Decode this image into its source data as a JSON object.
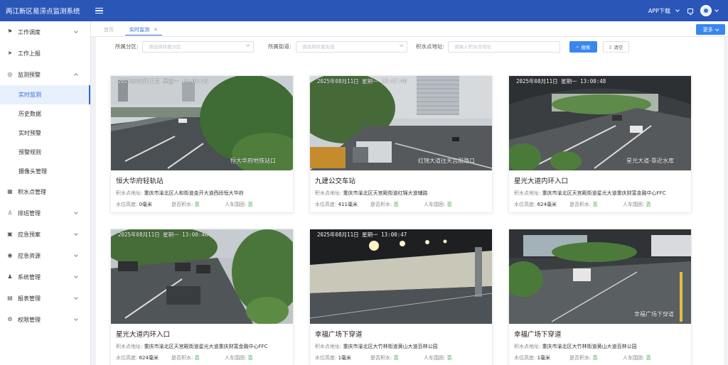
{
  "header": {
    "title": "两江新区易涝点监测系统",
    "app_download": "APP下载"
  },
  "sidebar": {
    "items": [
      {
        "label": "工作调度",
        "icon": "flag-icon",
        "expandable": true
      },
      {
        "label": "工作上报",
        "icon": "send-icon",
        "expandable": false
      },
      {
        "label": "监测预警",
        "icon": "alert-circle-icon",
        "expandable": true,
        "expanded": true,
        "children": [
          "实时监测",
          "历史数据",
          "实时预警",
          "预警规则",
          "摄像头管理"
        ]
      },
      {
        "label": "积水点管理",
        "icon": "grid-icon",
        "expandable": false
      },
      {
        "label": "排班管理",
        "icon": "user-icon",
        "expandable": true
      },
      {
        "label": "应急预案",
        "icon": "apps-icon",
        "expandable": true
      },
      {
        "label": "应急资源",
        "icon": "resource-icon",
        "expandable": true
      },
      {
        "label": "系统管理",
        "icon": "person-icon",
        "expandable": true
      },
      {
        "label": "报表管理",
        "icon": "report-icon",
        "expandable": true
      },
      {
        "label": "权限管理",
        "icon": "gear-icon",
        "expandable": true
      }
    ],
    "active_child": "实时监测"
  },
  "tabs": {
    "home": "首页",
    "active": "实时监测",
    "more": "更多"
  },
  "filters": {
    "district_label": "所属分区:",
    "district_placeholder": "请选择所属分区",
    "street_label": "所属街道:",
    "street_placeholder": "请选择所属街道",
    "point_label": "积水点地址:",
    "point_placeholder": "请输入积水点地址",
    "search": "搜索",
    "reset": "清空"
  },
  "labels": {
    "address": "积水点地址:",
    "water_level": "水位高度:",
    "is_flooded": "是否积水:",
    "car_trapped": "人车围困:"
  },
  "cards": [
    {
      "name": "恒大华府轻轨站",
      "address": "重庆市渝北区人和街道金开大道西段恒大华府",
      "water_level": "0毫米",
      "is_flooded": "否",
      "car_trapped": "否",
      "stamp": "2025年08月11日  星期一  13:00:46",
      "caption": "恒大华府地铁站口",
      "scene": "road"
    },
    {
      "name": "九建公交车站",
      "address": "重庆市渝北区天宫殿街道红锦大道辅路",
      "water_level": "411毫米",
      "is_flooded": "否",
      "car_trapped": "否",
      "stamp": "2025年08月11日  星期一  13:47:40",
      "caption": "红锦大道往天宫殿路口",
      "scene": "street"
    },
    {
      "name": "星光大道内环入口",
      "address": "重庆市渝北区天宫殿街道星光大道重庆财富金融中心FFC",
      "water_level": "624毫米",
      "is_flooded": "否",
      "car_trapped": "否",
      "stamp": "2025年08月11日  星期一  13:00:48",
      "caption": "星光大道-靠近水库",
      "scene": "bridge"
    },
    {
      "name": "星光大道内环入口",
      "address": "重庆市渝北区天宫殿街道星光大道重庆财富金融中心FFC",
      "water_level": "624毫米",
      "is_flooded": "否",
      "car_trapped": "否",
      "stamp": "2025年08月11日  星期一  13:00:46",
      "caption": "",
      "scene": "avenue"
    },
    {
      "name": "幸福广场下穿道",
      "address": "重庆市渝北区大竹林街道黄山大道百林公园",
      "water_level": "1毫米",
      "is_flooded": "否",
      "car_trapped": "否",
      "stamp": "2025年08月11日  星期一  13:00:47",
      "caption": "",
      "scene": "tunnel"
    },
    {
      "name": "幸福广场下穿道",
      "address": "重庆市渝北区大竹林街道黄山大道百林公园",
      "water_level": "1毫米",
      "is_flooded": "否",
      "car_trapped": "否",
      "stamp": "",
      "caption": "幸福广场下穿道",
      "scene": "underpass"
    }
  ],
  "colors": {
    "brand": "#2a56b8",
    "accent": "#2a6bd8",
    "ok": "#2aa44a"
  }
}
